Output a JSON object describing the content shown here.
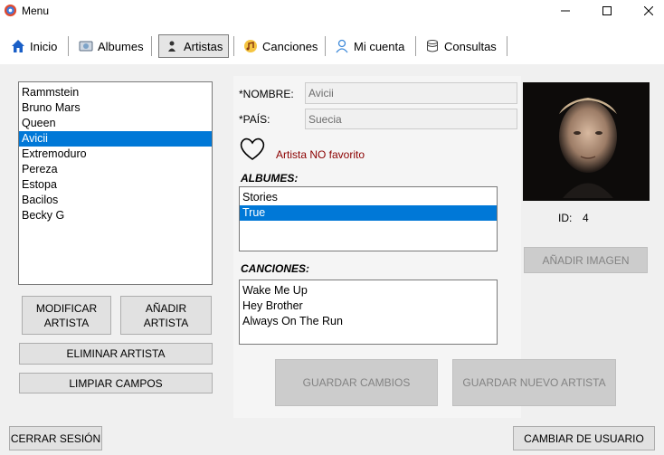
{
  "window": {
    "title": "Menu"
  },
  "tabs": [
    {
      "label": "Inicio",
      "icon": "home-icon"
    },
    {
      "label": "Albumes",
      "icon": "album-icon"
    },
    {
      "label": "Artistas",
      "icon": "artist-icon"
    },
    {
      "label": "Canciones",
      "icon": "songs-icon"
    },
    {
      "label": "Mi cuenta",
      "icon": "user-icon"
    },
    {
      "label": "Consultas",
      "icon": "query-icon"
    }
  ],
  "artists": {
    "items": [
      "Rammstein",
      "Bruno Mars",
      "Queen",
      "Avicii",
      "Extremoduro",
      "Pereza",
      "Estopa",
      "Bacilos",
      "Becky G"
    ],
    "selected": "Avicii"
  },
  "left_buttons": {
    "modify": "MODIFICAR ARTISTA",
    "add": "AÑADIR ARTISTA",
    "delete": "ELIMINAR ARTISTA",
    "clear": "LIMPIAR CAMPOS"
  },
  "form": {
    "name_label": "*NOMBRE:",
    "name_value": "Avicii",
    "country_label": "*PAÍS:",
    "country_value": "Suecia",
    "favorite_text": "Artista NO favorito",
    "favorite_color": "#8b0000"
  },
  "albums": {
    "header": "ALBUMES:",
    "items": [
      "Stories",
      "True"
    ],
    "selected": "True"
  },
  "songs": {
    "header": "CANCIONES:",
    "items": [
      "Wake Me Up",
      "Hey Brother",
      "Always On The Run"
    ]
  },
  "mid_buttons": {
    "save": "GUARDAR CAMBIOS",
    "save_new": "GUARDAR NUEVO ARTISTA"
  },
  "right": {
    "id_label": "ID:",
    "id_value": "4",
    "add_image": "AÑADIR IMAGEN"
  },
  "footer": {
    "logout": "CERRAR SESIÓN",
    "change_user": "CAMBIAR DE USUARIO"
  },
  "colors": {
    "selection": "#0078d7",
    "disabled_button": "#cccccc"
  }
}
